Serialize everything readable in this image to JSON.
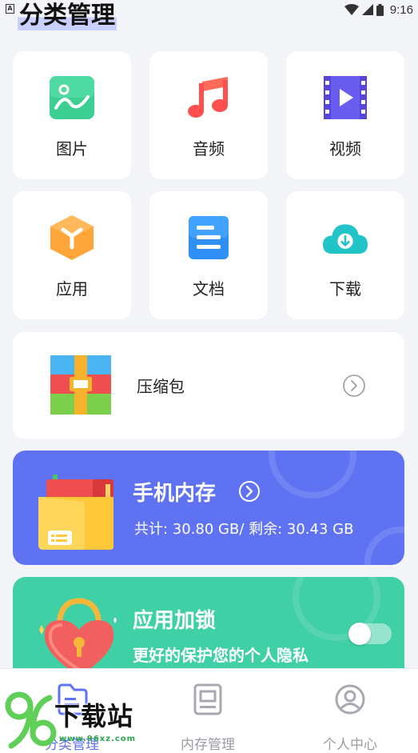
{
  "status_bar": {
    "notification_icon": "a-box-icon",
    "time": "9:16"
  },
  "header": {
    "title": "分类管理"
  },
  "categories": [
    {
      "label": "图片",
      "icon": "image-icon"
    },
    {
      "label": "音频",
      "icon": "music-note-icon"
    },
    {
      "label": "视频",
      "icon": "video-play-icon"
    },
    {
      "label": "应用",
      "icon": "app-cube-icon"
    },
    {
      "label": "文档",
      "icon": "document-icon"
    },
    {
      "label": "下载",
      "icon": "cloud-download-icon"
    }
  ],
  "archive": {
    "label": "压缩包",
    "icon": "archive-box-icon"
  },
  "memory": {
    "title": "手机内存",
    "info": "共计: 30.80 GB/ 剩余: 30.43 GB",
    "color": "#5f73f2"
  },
  "app_lock": {
    "title": "应用加锁",
    "subtitle": "更好的保护您的个人隐私",
    "toggle_on": false,
    "color": "#3fd0a6"
  },
  "bottom_nav": {
    "items": [
      {
        "label": "分类管理",
        "icon": "folder-icon",
        "active": true
      },
      {
        "label": "内存管理",
        "icon": "sd-card-icon",
        "active": false
      },
      {
        "label": "个人中心",
        "icon": "user-circle-icon",
        "active": false
      }
    ]
  },
  "watermark": {
    "brand": "下载站",
    "url": "www.96xz.com"
  }
}
